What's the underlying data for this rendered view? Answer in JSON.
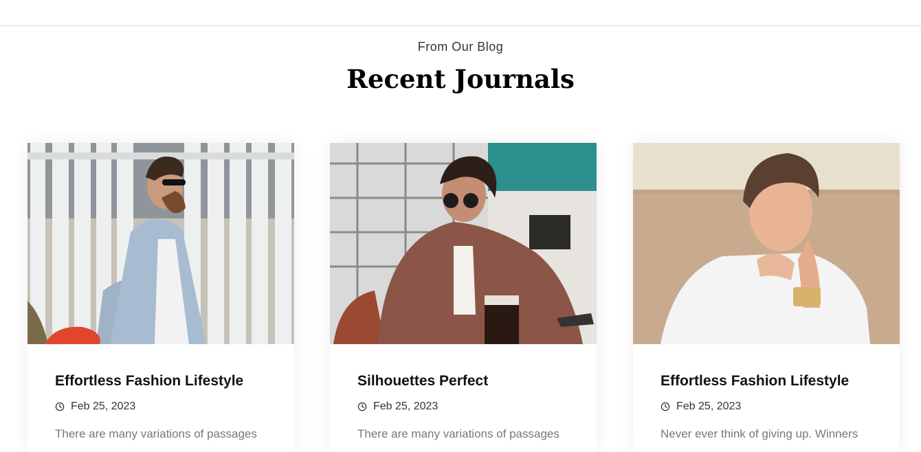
{
  "header": {
    "eyebrow": "From Our Blog",
    "title": "Recent Journals"
  },
  "posts": [
    {
      "title": "Effortless Fashion Lifestyle",
      "date": "Feb 25, 2023",
      "excerpt": "There are many variations of passages",
      "image_alt": "Man in denim jacket and sunglasses beside white fence"
    },
    {
      "title": "Silhouettes Perfect",
      "date": "Feb 25, 2023",
      "excerpt": "There are many variations of passages",
      "image_alt": "Man in sunglasses sitting at cafe table with drink"
    },
    {
      "title": "Effortless Fashion Lifestyle",
      "date": "Feb 25, 2023",
      "excerpt": "Never ever think of giving up. Winners",
      "image_alt": "Young man in white t-shirt with gold watch"
    }
  ],
  "icons": {
    "date": "clock-icon"
  },
  "colors": {
    "title": "#111111",
    "excerpt": "#777777",
    "divider": "#d9d9d9"
  }
}
